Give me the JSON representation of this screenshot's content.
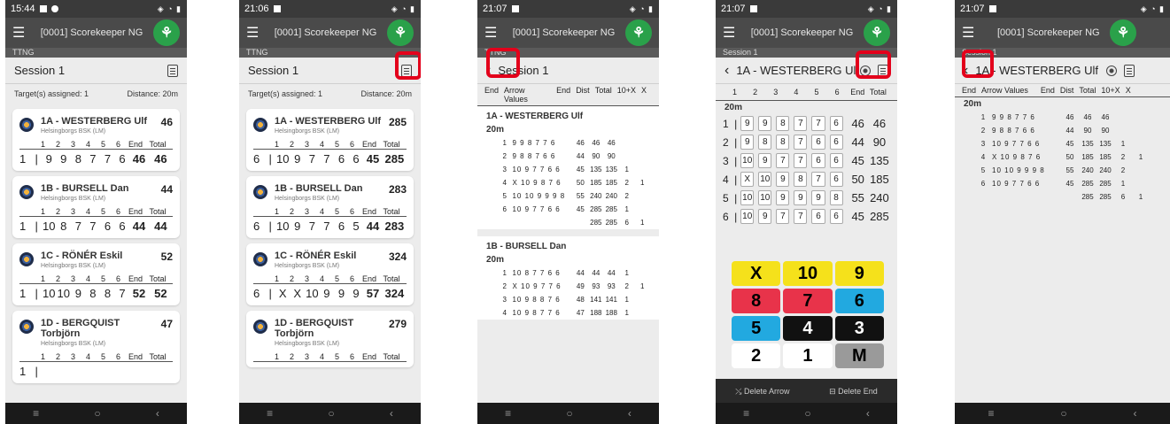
{
  "colors": {
    "accent_green": "#2aa14a",
    "highlight_red": "#e3001b",
    "dark_bar": "#4a4a4a"
  },
  "common": {
    "app_title": "[0001] Scorekeeper NG",
    "menu_icon": "hamburger-icon",
    "logo_icon": "tree-logo-icon",
    "session": "Session 1",
    "assigned": "Target(s) assigned: 1",
    "distance": "Distance: 20m",
    "col_end": "End",
    "col_total": "Total"
  },
  "p1": {
    "time": "15:44",
    "subbar": "TTNG",
    "cards": [
      {
        "name": "1A - WESTERBERG Ulf",
        "club": "Helsingborgs BSK (LM)",
        "total": "46",
        "row": {
          "num": "1",
          "arrows": [
            "9",
            "9",
            "8",
            "7",
            "7",
            "6"
          ],
          "end": "46",
          "total": "46"
        }
      },
      {
        "name": "1B - BURSELL Dan",
        "club": "Helsingborgs BSK (LM)",
        "total": "44",
        "row": {
          "num": "1",
          "arrows": [
            "10",
            "8",
            "7",
            "7",
            "6",
            "6"
          ],
          "end": "44",
          "total": "44"
        }
      },
      {
        "name": "1C - RÖNÉR Eskil",
        "club": "Helsingborgs BSK (LM)",
        "total": "52",
        "row": {
          "num": "1",
          "arrows": [
            "10",
            "10",
            "9",
            "8",
            "8",
            "7"
          ],
          "end": "52",
          "total": "52"
        }
      },
      {
        "name": "1D - BERGQUIST Torbjörn",
        "club": "Helsingborgs BSK (LM)",
        "total": "47",
        "row": {
          "num": "1",
          "arrows": [
            "",
            "",
            "",
            "",
            "",
            ""
          ],
          "end": "",
          "total": ""
        }
      }
    ],
    "ends": [
      "1",
      "2",
      "3",
      "4",
      "5",
      "6"
    ]
  },
  "p2": {
    "time": "21:06",
    "subbar": "TTNG",
    "cards": [
      {
        "name": "1A - WESTERBERG Ulf",
        "club": "Helsingborgs BSK (LM)",
        "total": "285",
        "row": {
          "num": "6",
          "arrows": [
            "10",
            "9",
            "7",
            "7",
            "6",
            "6"
          ],
          "end": "45",
          "total": "285"
        }
      },
      {
        "name": "1B - BURSELL Dan",
        "club": "Helsingborgs BSK (LM)",
        "total": "283",
        "row": {
          "num": "6",
          "arrows": [
            "10",
            "9",
            "7",
            "7",
            "6",
            "5"
          ],
          "end": "44",
          "total": "283"
        }
      },
      {
        "name": "1C - RÖNÉR Eskil",
        "club": "Helsingborgs BSK (LM)",
        "total": "324",
        "row": {
          "num": "6",
          "arrows": [
            "X",
            "X",
            "10",
            "9",
            "9",
            "9"
          ],
          "end": "57",
          "total": "324"
        }
      },
      {
        "name": "1D - BERGQUIST Torbjörn",
        "club": "Helsingborgs BSK (LM)",
        "total": "279",
        "row": {
          "num": "",
          "arrows": [],
          "end": "",
          "total": ""
        }
      }
    ]
  },
  "p3": {
    "time": "21:07",
    "subbar": "TTNG",
    "headers": {
      "end": "End",
      "arrows": "Arrow Values",
      "end2": "End",
      "dist": "Dist",
      "total": "Total",
      "ten": "10+X",
      "x": "X"
    },
    "archers": [
      {
        "name": "1A - WESTERBERG Ulf",
        "dist": "20m",
        "rows": [
          {
            "e": "1",
            "a": "9 9 8 7 7 6",
            "end": "46",
            "dist": "46",
            "total": "46",
            "ten": "",
            "x": ""
          },
          {
            "e": "2",
            "a": "9 8 8 7 6 6",
            "end": "44",
            "dist": "90",
            "total": "90",
            "ten": "",
            "x": ""
          },
          {
            "e": "3",
            "a": "10 9 7 7 6 6",
            "end": "45",
            "dist": "135",
            "total": "135",
            "ten": "1",
            "x": ""
          },
          {
            "e": "4",
            "a": "X 10 9 8 7 6",
            "end": "50",
            "dist": "185",
            "total": "185",
            "ten": "2",
            "x": "1"
          },
          {
            "e": "5",
            "a": "10 10 9 9 9 8",
            "end": "55",
            "dist": "240",
            "total": "240",
            "ten": "2",
            "x": ""
          },
          {
            "e": "6",
            "a": "10 9 7 7 6 6",
            "end": "45",
            "dist": "285",
            "total": "285",
            "ten": "1",
            "x": ""
          },
          {
            "e": "",
            "a": "",
            "end": "",
            "dist": "285",
            "total": "285",
            "ten": "6",
            "x": "1"
          }
        ]
      },
      {
        "name": "1B - BURSELL Dan",
        "dist": "20m",
        "rows": [
          {
            "e": "1",
            "a": "10 8 7 7 6 6",
            "end": "44",
            "dist": "44",
            "total": "44",
            "ten": "1",
            "x": ""
          },
          {
            "e": "2",
            "a": "X 10 9 7 7 6",
            "end": "49",
            "dist": "93",
            "total": "93",
            "ten": "2",
            "x": "1"
          },
          {
            "e": "3",
            "a": "10 9 8 8 7 6",
            "end": "48",
            "dist": "141",
            "total": "141",
            "ten": "1",
            "x": ""
          },
          {
            "e": "4",
            "a": "10 9 8 7 7 6",
            "end": "47",
            "dist": "188",
            "total": "188",
            "ten": "1",
            "x": ""
          }
        ]
      }
    ]
  },
  "p4": {
    "time": "21:07",
    "subbar": "Session 1",
    "archer": "1A - WESTERBERG Ulf",
    "dist": "20m",
    "tabs": [
      "1",
      "2",
      "3",
      "4",
      "5",
      "6",
      "End",
      "Total"
    ],
    "rows": [
      {
        "n": "1",
        "a": [
          "9",
          "9",
          "8",
          "7",
          "7",
          "6"
        ],
        "end": "46",
        "total": "46"
      },
      {
        "n": "2",
        "a": [
          "9",
          "8",
          "8",
          "7",
          "6",
          "6"
        ],
        "end": "44",
        "total": "90"
      },
      {
        "n": "3",
        "a": [
          "10",
          "9",
          "7",
          "7",
          "6",
          "6"
        ],
        "end": "45",
        "total": "135"
      },
      {
        "n": "4",
        "a": [
          "X",
          "10",
          "9",
          "8",
          "7",
          "6"
        ],
        "end": "50",
        "total": "185"
      },
      {
        "n": "5",
        "a": [
          "10",
          "10",
          "9",
          "9",
          "9",
          "8"
        ],
        "end": "55",
        "total": "240"
      },
      {
        "n": "6",
        "a": [
          "10",
          "9",
          "7",
          "7",
          "6",
          "6"
        ],
        "end": "45",
        "total": "285"
      }
    ],
    "keys": [
      "X",
      "10",
      "9",
      "8",
      "7",
      "6",
      "5",
      "4",
      "3",
      "2",
      "1",
      "M"
    ],
    "delete_arrow": "Delete Arrow",
    "delete_end": "Delete End"
  },
  "p5": {
    "time": "21:07",
    "subbar": "Session 1",
    "archer": "1A - WESTERBERG Ulf",
    "dist": "20m",
    "headers": {
      "end": "End",
      "arrows": "Arrow Values",
      "end2": "End",
      "dist": "Dist",
      "total": "Total",
      "ten": "10+X",
      "x": "X"
    },
    "rows": [
      {
        "e": "1",
        "a": "9 9 8 7 7 6",
        "end": "46",
        "dist": "46",
        "total": "46",
        "ten": "",
        "x": ""
      },
      {
        "e": "2",
        "a": "9 8 8 7 6 6",
        "end": "44",
        "dist": "90",
        "total": "90",
        "ten": "",
        "x": ""
      },
      {
        "e": "3",
        "a": "10 9 7 7 6 6",
        "end": "45",
        "dist": "135",
        "total": "135",
        "ten": "1",
        "x": ""
      },
      {
        "e": "4",
        "a": "X 10 9 8 7 6",
        "end": "50",
        "dist": "185",
        "total": "185",
        "ten": "2",
        "x": "1"
      },
      {
        "e": "5",
        "a": "10 10 9 9 9 8",
        "end": "55",
        "dist": "240",
        "total": "240",
        "ten": "2",
        "x": ""
      },
      {
        "e": "6",
        "a": "10 9 7 7 6 6",
        "end": "45",
        "dist": "285",
        "total": "285",
        "ten": "1",
        "x": ""
      },
      {
        "e": "",
        "a": "",
        "end": "",
        "dist": "285",
        "total": "285",
        "ten": "6",
        "x": "1"
      }
    ]
  }
}
